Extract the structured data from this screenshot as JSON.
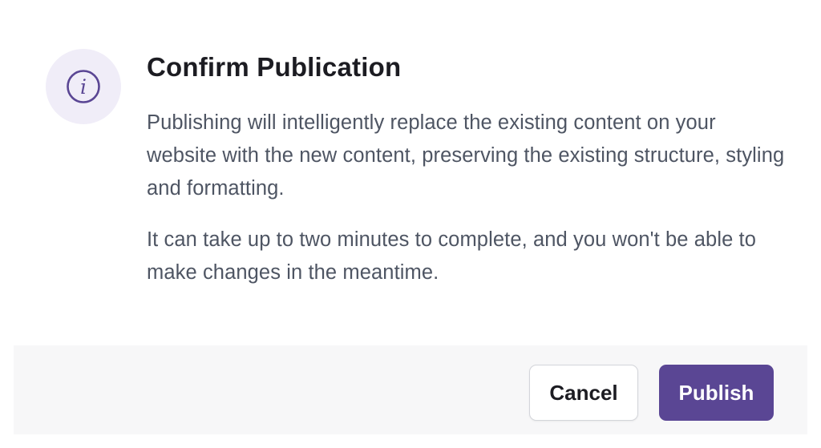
{
  "dialog": {
    "icon": "info-icon",
    "title": "Confirm Publication",
    "paragraphs": [
      "Publishing will intelligently replace the existing content on your website with the new content, preserving the existing structure, styling and formatting.",
      "It can take up to two minutes to complete, and you won't be able to make changes in the meantime."
    ]
  },
  "footer": {
    "cancel_label": "Cancel",
    "publish_label": "Publish"
  },
  "colors": {
    "accent": "#5a4694",
    "icon_bg": "#f0edf8",
    "footer_bg": "#f7f7f8",
    "text": "#4e5563"
  }
}
